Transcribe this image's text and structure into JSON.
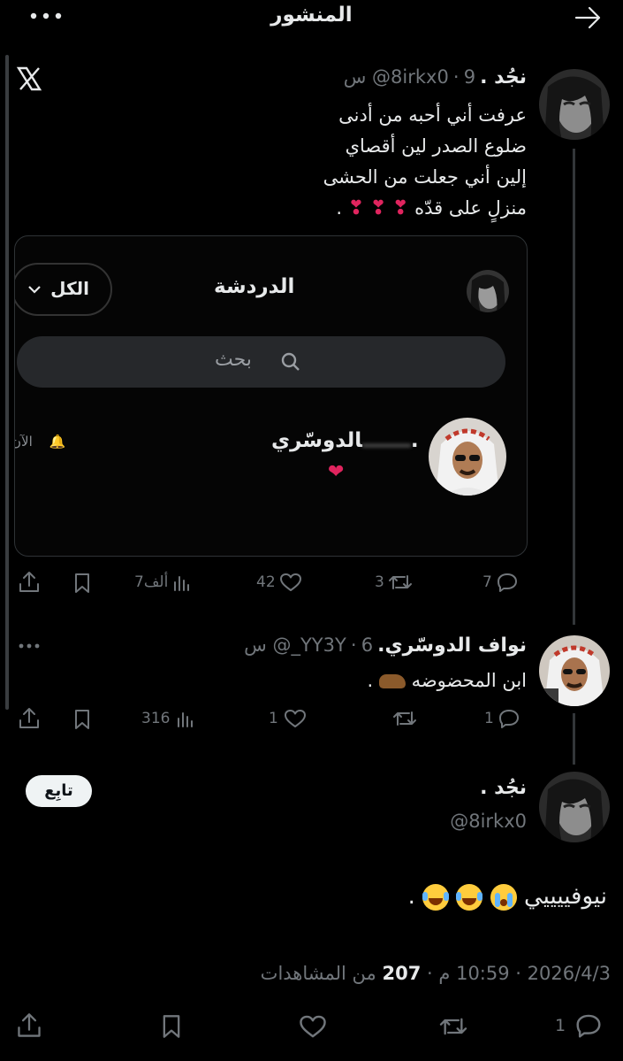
{
  "header": {
    "title": "المنشور",
    "back_icon": "arrow-right-icon",
    "more_icon": "more-dots-icon"
  },
  "quoted_post": {
    "name": "نجُد .",
    "handle": "@8irkx0",
    "time": "9 س",
    "separator": "·",
    "lines": [
      "عرفت أني أحبه من أدنى",
      "ضلوع الصدر لين أقصاي",
      "إلين أني جعلت من الحشى",
      "منزلٍ على قدّه"
    ],
    "line_end_mark": ".",
    "platform_logo": "X",
    "embedded_screenshot": {
      "title": "الدردشة",
      "filter_label": "الكل",
      "search_placeholder": "بحث",
      "contact_name": "الدوسّري.",
      "time_label": "الآن"
    },
    "actions": {
      "replies": "7",
      "retweets": "3",
      "likes": "42",
      "views": "7ألف"
    }
  },
  "reply_post": {
    "name": "نواف الدوسّري.",
    "handle": "@_YY3Y",
    "time": "6 س",
    "separator": "·",
    "text": "ابن المحضوضه",
    "text_end_mark": ".",
    "actions": {
      "replies": "1",
      "retweets": "",
      "likes": "1",
      "views": "316"
    }
  },
  "main_post": {
    "name": "نجُد .",
    "handle": "@8irkx0",
    "follow_label": "تابِع",
    "text": "نيوفييييي",
    "text_end_mark": ".",
    "date": "2026/4/3",
    "time": "10:59 م",
    "views_count": "207",
    "views_label": "من المشاهدات",
    "separator": "·",
    "actions": {
      "replies": "1"
    }
  },
  "colors": {
    "background": "#000000",
    "text": "#e7e9ea",
    "muted": "#71767b",
    "heart": "#e0245e"
  }
}
